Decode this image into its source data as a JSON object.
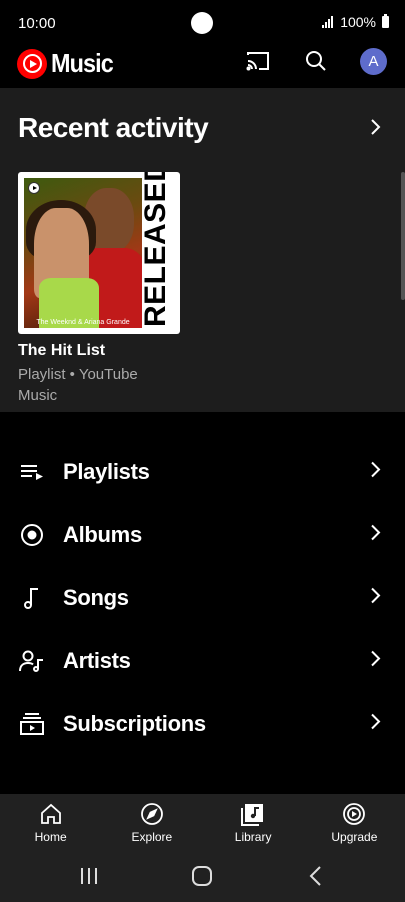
{
  "status_bar": {
    "time": "10:00",
    "battery": "100%",
    "icons": [
      "signal-icon",
      "battery-icon"
    ]
  },
  "header": {
    "logo_text": "Music",
    "avatar_letter": "A",
    "actions": [
      "cast-icon",
      "search-icon",
      "avatar"
    ],
    "brand_color": "#ff0000",
    "avatar_color": "#5e6ccb"
  },
  "recent": {
    "title": "Recent activity",
    "item": {
      "thumb_side_text": "RELEASED",
      "thumb_caption": "The Weeknd & Ariana Grande",
      "title": "The Hit List",
      "subtitle": "Playlist • YouTube Music"
    }
  },
  "library_menu": [
    {
      "label": "Playlists",
      "icon": "playlist-icon"
    },
    {
      "label": "Albums",
      "icon": "album-icon"
    },
    {
      "label": "Songs",
      "icon": "music-note-icon"
    },
    {
      "label": "Artists",
      "icon": "artist-icon"
    },
    {
      "label": "Subscriptions",
      "icon": "subscriptions-icon"
    }
  ],
  "bottom_nav": [
    {
      "label": "Home",
      "icon": "home-icon"
    },
    {
      "label": "Explore",
      "icon": "compass-icon"
    },
    {
      "label": "Library",
      "icon": "library-icon",
      "active": true
    },
    {
      "label": "Upgrade",
      "icon": "upgrade-icon"
    }
  ],
  "system_nav": [
    "recents-icon",
    "home-circle-icon",
    "back-icon"
  ]
}
